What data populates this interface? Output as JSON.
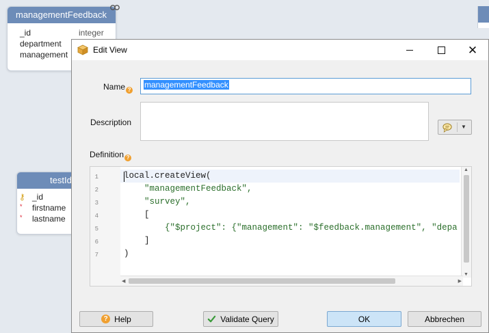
{
  "background": {
    "entity1": {
      "title": "managementFeedback",
      "fields": [
        {
          "name": "_id",
          "type": "integer"
        },
        {
          "name": "department",
          "type": ""
        },
        {
          "name": "management",
          "type": ""
        }
      ]
    },
    "entity2": {
      "title": "testId",
      "fields": [
        {
          "name": "_id"
        },
        {
          "name": "firstname"
        },
        {
          "name": "lastname"
        }
      ]
    }
  },
  "dialog": {
    "title": "Edit View",
    "name_label": "Name",
    "name_value": "managementFeedback",
    "description_label": "Description",
    "description_value": "",
    "definition_label": "Definition",
    "code_lines": [
      {
        "no": "1",
        "text": "local.createView("
      },
      {
        "no": "2",
        "text": "    \"managementFeedback\","
      },
      {
        "no": "3",
        "text": "    \"survey\","
      },
      {
        "no": "4",
        "text": "    ["
      },
      {
        "no": "5",
        "text": "        {\"$project\": {\"management\": \"$feedback.management\", \"depa"
      },
      {
        "no": "6",
        "text": "    ]"
      },
      {
        "no": "7",
        "text": ")"
      }
    ],
    "buttons": {
      "help": "Help",
      "validate": "Validate Query",
      "ok": "OK",
      "cancel": "Abbrechen"
    }
  },
  "colors": {
    "entity_header": "#6d8cb8",
    "accent": "#3390ff",
    "ok_button": "#cce4f7"
  }
}
